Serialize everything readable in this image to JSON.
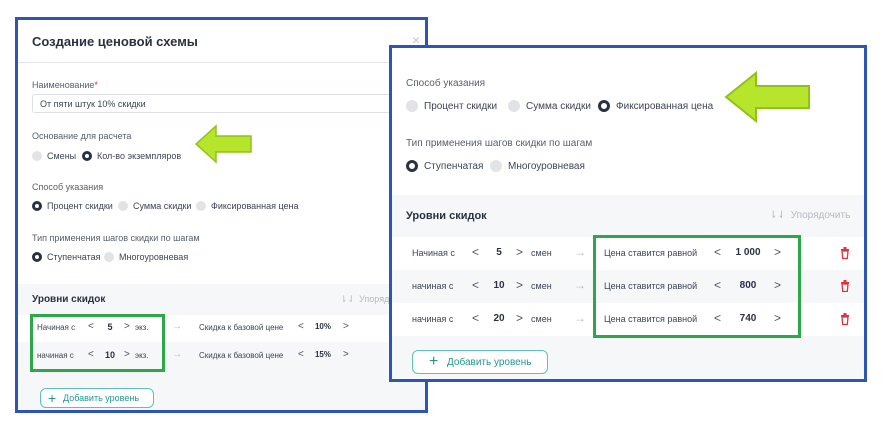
{
  "left": {
    "title": "Создание ценовой схемы",
    "close_glyph": "×",
    "name_label": "Наименование",
    "required_mark": "*",
    "name_value": "От пяти штук 10% скидки",
    "basis_label": "Основание для расчета",
    "basis_options": [
      "Смены",
      "Кол-во экземпляров"
    ],
    "method_label": "Способ указания",
    "method_options": [
      "Процент скидки",
      "Сумма скидки",
      "Фиксированная цена"
    ],
    "type_label": "Тип применения шагов скидки по шагам",
    "type_options": [
      "Ступенчатая",
      "Многоуровневая"
    ],
    "levels_title": "Уровни скидок",
    "sort_label": "Упорядо",
    "rows": [
      {
        "prefix": "Начиная с",
        "qty": "5",
        "unit": "экз.",
        "desc": "Скидка к базовой цене",
        "val": "10%"
      },
      {
        "prefix": "начиная с",
        "qty": "10",
        "unit": "экз.",
        "desc": "Скидка к базовой цене",
        "val": "15%"
      }
    ],
    "add_label": "Добавить уровень"
  },
  "right": {
    "method_label": "Способ указания",
    "method_options": [
      "Процент скидки",
      "Сумма скидки",
      "Фиксированная цена"
    ],
    "type_label": "Тип применения шагов скидки по шагам",
    "type_options": [
      "Ступенчатая",
      "Многоуровневая"
    ],
    "levels_title": "Уровни скидок",
    "sort_label": "Упорядочить",
    "rows": [
      {
        "prefix": "Начиная с",
        "qty": "5",
        "unit": "смен",
        "desc": "Цена ставится равной",
        "val": "1 000"
      },
      {
        "prefix": "начиная с",
        "qty": "10",
        "unit": "смен",
        "desc": "Цена ставится равной",
        "val": "800"
      },
      {
        "prefix": "начиная с",
        "qty": "20",
        "unit": "смен",
        "desc": "Цена ставится равной",
        "val": "740"
      }
    ],
    "add_label": "Добавить уровень"
  },
  "glyphs": {
    "left": "<",
    "right": ">",
    "arrow": "→",
    "plus": "+"
  },
  "colors": {
    "panel_border": "#2e55b6",
    "highlight": "#2ea64a",
    "arrow_fill": "#b7e52c",
    "arrow_stroke": "#8fc21a",
    "accent": "#23978e",
    "delete": "#e0323b",
    "dark": "#2a3142"
  }
}
